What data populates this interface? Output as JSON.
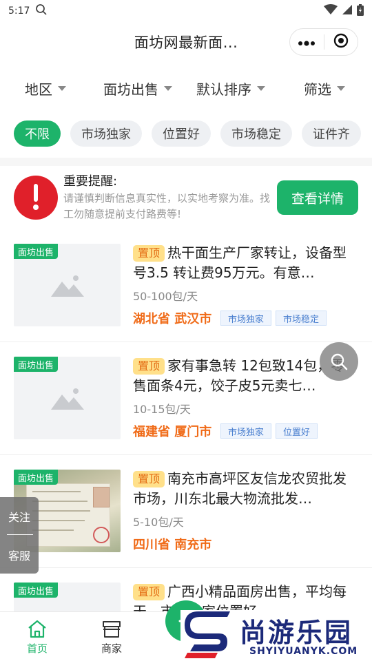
{
  "status_bar": {
    "time": "5:17"
  },
  "header": {
    "title": "面坊网最新面..."
  },
  "filters": [
    {
      "label": "地区"
    },
    {
      "label": "面坊出售"
    },
    {
      "label": "默认排序"
    },
    {
      "label": "筛选"
    }
  ],
  "tags": [
    "不限",
    "市场独家",
    "位置好",
    "市场稳定",
    "证件齐"
  ],
  "notice": {
    "title": "重要提醒:",
    "body": "请谨慎判断信息真实性，以实地考察为准。找工勿随意提前支付路费等!",
    "button": "查看详情"
  },
  "listings": [
    {
      "badge": "面坊出售",
      "top_label": "置顶",
      "title": "热干面生产厂家转让，设备型号3.5 转让费95万元。有意…",
      "output": "50-100包/天",
      "location": "湖北省 武汉市",
      "chips": [
        "市场独家",
        "市场稳定"
      ]
    },
    {
      "badge": "面坊出售",
      "top_label": "置顶",
      "title": "家有事急转 12包致14包，零售面条4元，饺子皮5元卖七…",
      "output": "10-15包/天",
      "location": "福建省 厦门市",
      "chips": [
        "市场独家",
        "位置好"
      ]
    },
    {
      "badge": "面坊出售",
      "top_label": "置顶",
      "title": "南充市高坪区友信龙农贸批发市场，川东北最大物流批发…",
      "output": "5-10包/天",
      "location": "四川省 南充市",
      "chips": []
    },
    {
      "badge": "面坊出售",
      "top_label": "置顶",
      "title": "广西小精品面房出售，平均每天…市场独家位置好…",
      "output": "",
      "location": "",
      "chips": []
    }
  ],
  "side_tab": {
    "follow": "关注",
    "service": "客服"
  },
  "tabbar": {
    "home": "首页",
    "merchant": "商家"
  },
  "watermark": {
    "brand": "尚游乐园",
    "domain": "SHYIYUANYK.COM"
  },
  "colors": {
    "accent": "#1db36a",
    "warning": "#e0202a",
    "location": "#f06b18"
  }
}
